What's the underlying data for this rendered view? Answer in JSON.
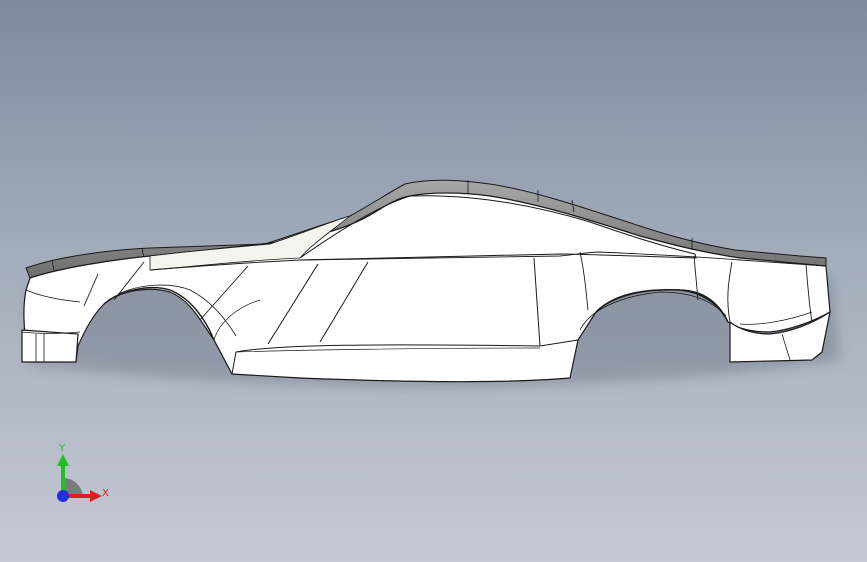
{
  "viewport": {
    "background_top": "#7d8a9e",
    "background_bottom": "#c4cad4"
  },
  "model": {
    "face_color": "#ffffff",
    "edge_color": "#1a1a1a",
    "roof_strip_color": "#8f8f8f"
  },
  "triad": {
    "x_label": "X",
    "y_label": "Y",
    "x_color": "#e02020",
    "y_color": "#20c020",
    "z_color": "#2030e0",
    "icons": [
      "coordinate-triad-icon"
    ]
  }
}
